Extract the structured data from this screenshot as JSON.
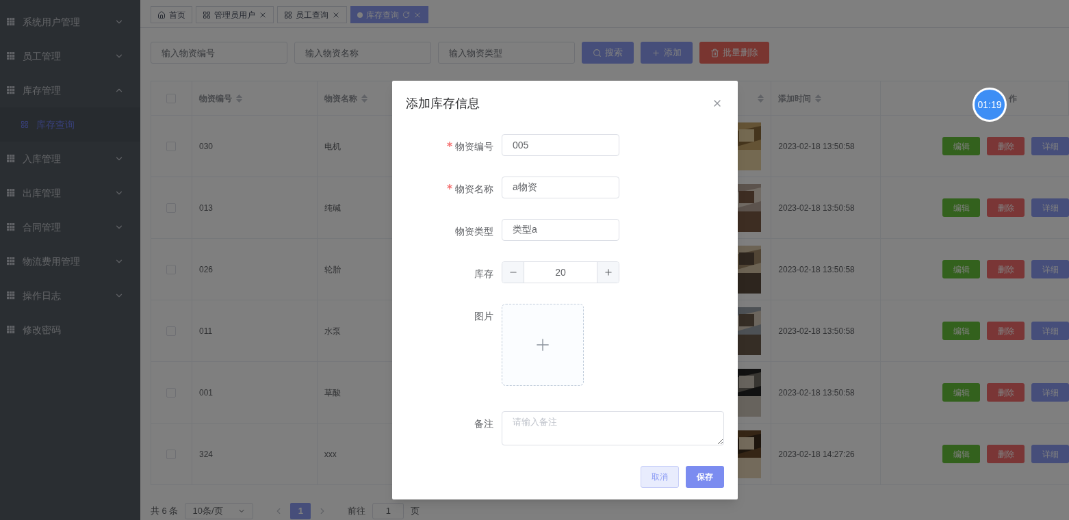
{
  "sidebar": {
    "items": [
      {
        "label": "系统用户管理",
        "kind": "submenu",
        "expanded": false
      },
      {
        "label": "员工管理",
        "kind": "submenu",
        "expanded": false
      },
      {
        "label": "库存管理",
        "kind": "submenu",
        "expanded": true,
        "children": [
          {
            "label": "库存查询",
            "selected": true
          }
        ]
      },
      {
        "label": "入库管理",
        "kind": "submenu",
        "expanded": false
      },
      {
        "label": "出库管理",
        "kind": "submenu",
        "expanded": false
      },
      {
        "label": "合同管理",
        "kind": "submenu",
        "expanded": false
      },
      {
        "label": "物流费用管理",
        "kind": "submenu",
        "expanded": false
      },
      {
        "label": "操作日志",
        "kind": "submenu",
        "expanded": false
      },
      {
        "label": "修改密码",
        "kind": "link"
      }
    ]
  },
  "tabs": [
    {
      "label": "首页",
      "kind": "home",
      "selected": false,
      "closable": false
    },
    {
      "label": "管理员用户",
      "kind": "page",
      "selected": false,
      "closable": true
    },
    {
      "label": "员工查询",
      "kind": "page",
      "selected": false,
      "closable": true
    },
    {
      "label": "库存查询",
      "kind": "page",
      "selected": true,
      "closable": true
    }
  ],
  "search": {
    "fields": [
      {
        "placeholder": "输入物资编号"
      },
      {
        "placeholder": "输入物资名称"
      },
      {
        "placeholder": "输入物资类型"
      }
    ],
    "buttons": [
      {
        "label": "搜索",
        "kind": "search"
      },
      {
        "label": "添加",
        "kind": "add"
      },
      {
        "label": "批量删除",
        "kind": "delete"
      }
    ]
  },
  "table": {
    "header_checked": false,
    "columns": [
      {
        "label": "物资编号",
        "sortable": true
      },
      {
        "label": "物资名称",
        "sortable": true
      },
      {
        "kind": "hidden"
      },
      {
        "kind": "picture",
        "sortable": true
      },
      {
        "label": "添加时间",
        "sortable": true
      },
      {
        "label": "作",
        "sortable": false
      }
    ],
    "rows": [
      {
        "checked": false,
        "code": "030",
        "name": "电机",
        "added": "2023-02-18 13:50:58",
        "actions": [
          "编辑",
          "删除",
          "详细"
        ]
      },
      {
        "checked": false,
        "code": "013",
        "name": "纯碱",
        "added": "2023-02-18 13:50:58",
        "actions": [
          "编辑",
          "删除",
          "详细"
        ]
      },
      {
        "checked": false,
        "code": "026",
        "name": "轮胎",
        "added": "2023-02-18 13:50:58",
        "actions": [
          "编辑",
          "删除",
          "详细"
        ]
      },
      {
        "checked": false,
        "code": "011",
        "name": "水泵",
        "added": "2023-02-18 13:50:58",
        "actions": [
          "编辑",
          "删除",
          "详细"
        ]
      },
      {
        "checked": false,
        "code": "001",
        "name": "草酸",
        "added": "2023-02-18 13:50:58",
        "actions": [
          "编辑",
          "删除",
          "详细"
        ]
      },
      {
        "checked": false,
        "code": "324",
        "name": "xxx",
        "added": "2023-02-18 14:27:26",
        "actions": [
          "编辑",
          "删除",
          "详细"
        ]
      }
    ]
  },
  "pagination": {
    "total": "共 6 条",
    "page_size": "10条/页",
    "pages": [
      {
        "label": "1",
        "selected": true
      }
    ],
    "goto_label": "前往",
    "goto_value": "1",
    "goto_suffix": "页"
  },
  "timer": "01:19",
  "dialog": {
    "title": "添加库存信息",
    "fields": [
      {
        "kind": "text",
        "label": "物资编号",
        "required": true,
        "value": "005"
      },
      {
        "kind": "text",
        "label": "物资名称",
        "required": true,
        "value": "a物资"
      },
      {
        "kind": "text",
        "label": "物资类型",
        "required": false,
        "value": "类型a"
      },
      {
        "kind": "number",
        "label": "库存",
        "required": false,
        "value": "20"
      },
      {
        "kind": "upload",
        "label": "图片",
        "required": false
      },
      {
        "kind": "textarea",
        "label": "备注",
        "required": false,
        "placeholder": "请输入备注"
      }
    ],
    "buttons": [
      {
        "label": "取消",
        "kind": "default"
      },
      {
        "label": "保存",
        "kind": "primary"
      }
    ]
  }
}
